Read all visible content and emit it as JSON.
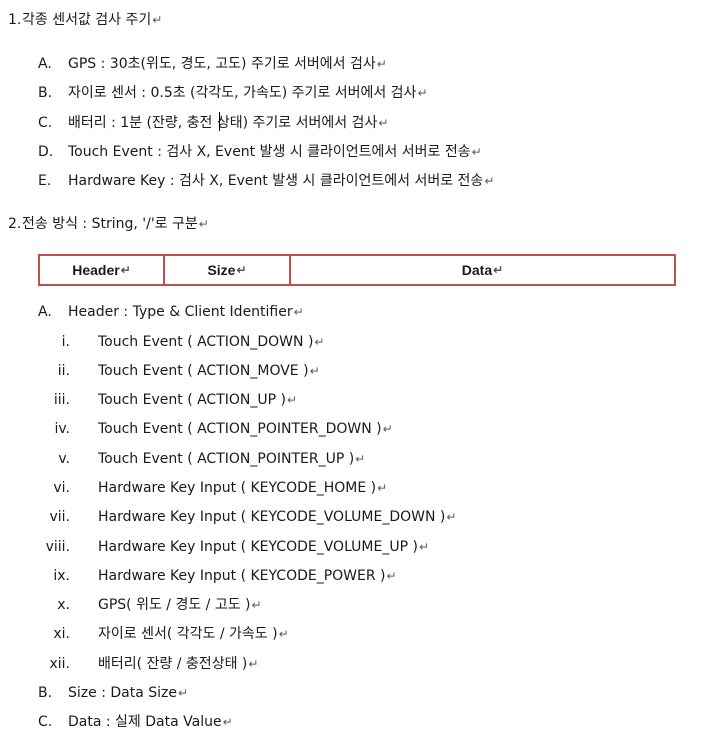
{
  "sections": [
    {
      "num": "1.",
      "text": "각종 센서값 검사 주기"
    },
    {
      "num": "2.",
      "text": "전송 방식 : String, '/'로 구분"
    }
  ],
  "sec1_items": [
    {
      "label": "A.",
      "text": "GPS : 30초(위도, 경도, 고도) 주기로 서버에서 검사"
    },
    {
      "label": "B.",
      "text": "자이로 센서 : 0.5초 (각각도, 가속도) 주기로 서버에서 검사"
    },
    {
      "label": "C.",
      "text": "배터리 : 1분 (잔량, 충전 상태) 주기로 서버에서 검사"
    },
    {
      "label": "D.",
      "text": "Touch Event : 검사 X, Event 발생 시 클라이언트에서 서버로 전송"
    },
    {
      "label": "E.",
      "text": "Hardware Key : 검사 X, Event 발생 시 클라이언트에서 서버로 전송"
    }
  ],
  "table": {
    "header": "Header",
    "size": "Size",
    "data": "Data"
  },
  "sec2_items": [
    {
      "label": "A.",
      "text": "Header : Type & Client Identifier"
    },
    {
      "label": "B.",
      "text": "Size : Data Size"
    },
    {
      "label": "C.",
      "text": "Data : 실제 Data Value"
    }
  ],
  "sub_items": [
    {
      "label": "i.",
      "text": "Touch Event ( ACTION_DOWN )"
    },
    {
      "label": "ii.",
      "text": "Touch Event ( ACTION_MOVE )"
    },
    {
      "label": "iii.",
      "text": "Touch Event ( ACTION_UP )"
    },
    {
      "label": "iv.",
      "text": "Touch Event ( ACTION_POINTER_DOWN )"
    },
    {
      "label": "v.",
      "text": "Touch Event ( ACTION_POINTER_UP )"
    },
    {
      "label": "vi.",
      "text": "Hardware Key Input ( KEYCODE_HOME )"
    },
    {
      "label": "vii.",
      "text": "Hardware Key Input ( KEYCODE_VOLUME_DOWN )"
    },
    {
      "label": "viii.",
      "text": "Hardware Key Input ( KEYCODE_VOLUME_UP )"
    },
    {
      "label": "ix.",
      "text": "Hardware Key Input ( KEYCODE_POWER )"
    },
    {
      "label": "x.",
      "text": "GPS( 위도 / 경도 / 고도 )"
    },
    {
      "label": "xi.",
      "text": "자이로 센서( 각각도 / 가속도 )"
    },
    {
      "label": "xii.",
      "text": "배터리( 잔량 / 충전상태 )"
    }
  ],
  "paragraph_mark": "↵",
  "colors": {
    "table_border": "#c0504d",
    "spellcheck": "#d23b3b"
  }
}
